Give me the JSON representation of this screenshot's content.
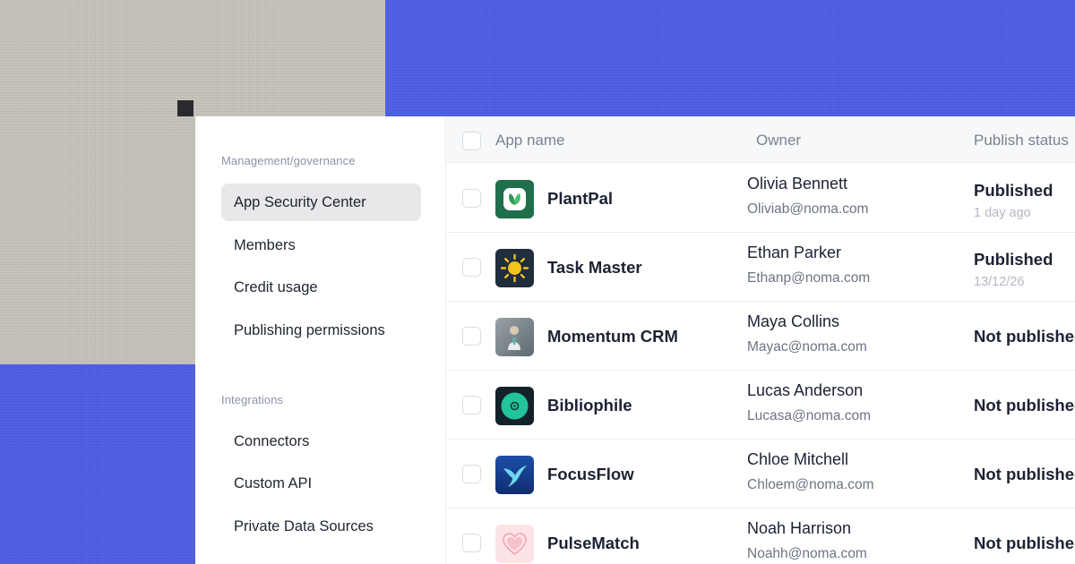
{
  "colors": {
    "accent_blue": "#4a5be0",
    "gray_bg": "#c9c5be",
    "active_nav": "#e8e8ea"
  },
  "sidebar": {
    "section1_label": "Management/governance",
    "section1_items": [
      {
        "label": "App Security Center",
        "active": true
      },
      {
        "label": "Members",
        "active": false
      },
      {
        "label": "Credit usage",
        "active": false
      },
      {
        "label": "Publishing permissions",
        "active": false
      }
    ],
    "section2_label": "Integrations",
    "section2_items": [
      {
        "label": "Connectors"
      },
      {
        "label": "Custom API"
      },
      {
        "label": "Private Data Sources"
      }
    ]
  },
  "table": {
    "headers": {
      "app_name": "App name",
      "owner": "Owner",
      "publish_status": "Publish status"
    },
    "rows": [
      {
        "icon": "plant-icon",
        "app": "PlantPal",
        "owner": "Olivia Bennett",
        "email": "Oliviab@noma.com",
        "status": "Published",
        "time": "1 day ago"
      },
      {
        "icon": "sun-icon",
        "app": "Task Master",
        "owner": "Ethan Parker",
        "email": "Ethanp@noma.com",
        "status": "Published",
        "time": "13/12/26"
      },
      {
        "icon": "person-photo-icon",
        "app": "Momentum CRM",
        "owner": "Maya Collins",
        "email": "Mayac@noma.com",
        "status": "Not published",
        "time": ""
      },
      {
        "icon": "target-icon",
        "app": "Bibliophile",
        "owner": "Lucas Anderson",
        "email": "Lucasa@noma.com",
        "status": "Not published",
        "time": ""
      },
      {
        "icon": "bird-icon",
        "app": "FocusFlow",
        "owner": "Chloe Mitchell",
        "email": "Chloem@noma.com",
        "status": "Not published",
        "time": ""
      },
      {
        "icon": "heart-icon",
        "app": "PulseMatch",
        "owner": "Noah Harrison",
        "email": "Noahh@noma.com",
        "status": "Not published",
        "time": ""
      }
    ]
  }
}
